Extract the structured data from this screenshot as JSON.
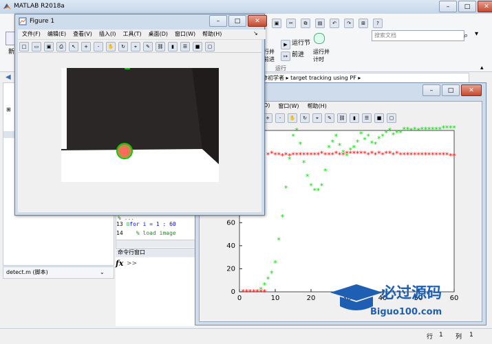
{
  "matlab": {
    "title": "MATLAB R2018a",
    "search_placeholder": "搜索文档",
    "ribbon": {
      "run_section_label": "运行节",
      "advance_label": "前进",
      "run_and_advance": "行并\n前进",
      "run_and_time": "运行并\n计时",
      "section_caption": "运行",
      "new_label": "新"
    },
    "breadcrumb": [
      "命初学者",
      "target tracking using PF"
    ],
    "editor_lines": [
      {
        "num": "",
        "text": "% ..."
      },
      {
        "num": "13",
        "text": "for i = 1 : 60"
      },
      {
        "num": "14",
        "text": "  % load image"
      }
    ],
    "command_window_title": "命令行窗口",
    "command_prompt": ">>",
    "fx_label": "fx",
    "current_file": "detect.m  (脚本)",
    "status": {
      "row_label": "行",
      "row": "1",
      "col_label": "列",
      "col": "1"
    }
  },
  "figure1": {
    "title": "Figure 1",
    "menu": [
      "文件(F)",
      "编辑(E)",
      "查看(V)",
      "插入(I)",
      "工具(T)",
      "桌面(D)",
      "窗口(W)",
      "帮助(H)"
    ]
  },
  "figure2": {
    "menu": [
      "(D)",
      "窗口(W)",
      "帮助(H)"
    ]
  },
  "chart_data": {
    "type": "scatter",
    "xlim": [
      0,
      60
    ],
    "ylim": [
      0,
      140
    ],
    "x_ticks": [
      "0",
      "10",
      "20",
      "30",
      "40",
      "50",
      "60"
    ],
    "y_ticks": [
      "0",
      "20",
      "40",
      "60",
      "80"
    ],
    "series": [
      {
        "color": "#ff0000",
        "marker": "*",
        "x": [
          1,
          2,
          3,
          4,
          5,
          6,
          7,
          8,
          9,
          10,
          11,
          12,
          13,
          14,
          15,
          16,
          17,
          18,
          19,
          20,
          21,
          22,
          23,
          24,
          25,
          26,
          27,
          28,
          29,
          30,
          31,
          32,
          33,
          34,
          35,
          36,
          37,
          38,
          39,
          40,
          41,
          42,
          43,
          44,
          45,
          46,
          47,
          48,
          49,
          50,
          51,
          52,
          53,
          54,
          55,
          56,
          57,
          58,
          59,
          60
        ],
        "y": [
          0,
          0,
          0,
          0,
          0,
          0,
          0,
          119,
          120,
          119,
          119,
          118,
          119,
          118,
          119,
          119,
          119,
          119,
          119,
          119,
          119,
          119,
          120,
          119,
          119,
          119,
          120,
          119,
          119,
          120,
          120,
          120,
          120,
          120,
          120,
          119,
          120,
          119,
          120,
          119,
          120,
          120,
          119,
          120,
          119,
          119,
          119,
          119,
          119,
          119,
          119,
          119,
          119,
          119,
          119,
          119,
          119,
          119,
          118,
          118
        ]
      },
      {
        "color": "#00dd00",
        "marker": "*",
        "x": [
          6,
          7,
          8,
          9,
          10,
          11,
          12,
          13,
          14,
          15,
          16,
          17,
          18,
          19,
          20,
          21,
          22,
          23,
          24,
          25,
          26,
          27,
          28,
          29,
          30,
          31,
          32,
          33,
          34,
          35,
          36,
          37,
          38,
          39,
          40,
          41,
          42,
          43,
          44,
          45,
          46,
          47,
          48,
          49,
          50,
          51,
          52,
          53,
          54,
          55,
          56,
          57,
          58,
          59,
          60
        ],
        "y": [
          2,
          6,
          11,
          16,
          25,
          45,
          65,
          90,
          115,
          135,
          140,
          128,
          112,
          100,
          92,
          88,
          88,
          92,
          105,
          125,
          130,
          135,
          127,
          121,
          118,
          123,
          125,
          130,
          137,
          132,
          135,
          129,
          128,
          133,
          135,
          138,
          140,
          136,
          138,
          138,
          141,
          141,
          140,
          141,
          140,
          141,
          141,
          141,
          141,
          141,
          141,
          142,
          142,
          142,
          142
        ]
      }
    ]
  },
  "colors": {
    "accent": "#3d6db5",
    "red_series": "#ff0000",
    "green_series": "#00dd00"
  },
  "watermark": {
    "brand": "必过源码",
    "site": "Biguo100.com"
  }
}
